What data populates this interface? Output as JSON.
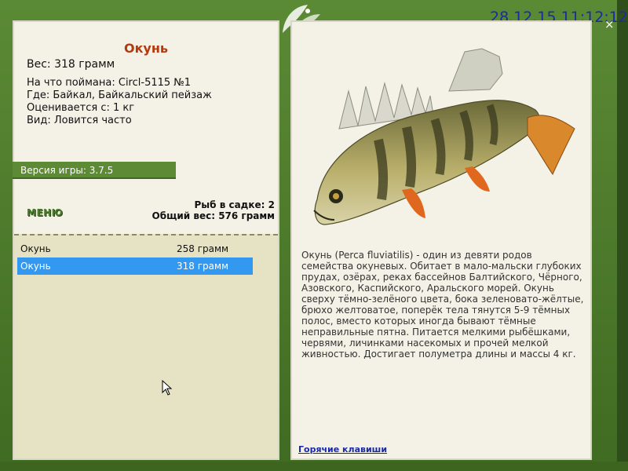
{
  "timestamp": "28.12.15 11:12:12",
  "fish": {
    "title": "Окунь",
    "weight_line": "Вес: 318 грамм",
    "caught_with": "На что поймана: Circl-5115 №1",
    "where": "Где: Байкал, Байкальский пейзаж",
    "valued_from": "Оценивается с: 1 кг",
    "kind": "Вид: Ловится часто"
  },
  "version": "Версия игры: 3.7.5",
  "menu_label": "МЕНЮ",
  "stats": {
    "in_net": "Рыб в садке: 2",
    "total_weight": "Общий вес: 576 грамм"
  },
  "catch_list": [
    {
      "name": "Окунь",
      "weight": "258 грамм"
    },
    {
      "name": "Окунь",
      "weight": "318 грамм"
    }
  ],
  "description": "Окунь (Perca fluviatilis) - один из девяти родов семейства окуневых. Обитает в мало-мальски глубоких прудах, озёрах, реках бассейнов Балтийского, Чёрного, Азовского, Каспийского, Аральского морей. Окунь сверху тёмно-зелёного цвета, бока зеленовато-жёлтые, брюхо желтоватое, поперёк тела тянутся 5-9 тёмных полос, вместо которых иногда бывают тёмные неправильные пятна. Питается мелкими рыбёшками, червями, личинками насекомых и прочей мелкой живностью. Достигает полуметра длины и массы 4 кг.",
  "hotkeys_label": "Горячие клавиши",
  "close_label": "×",
  "colors": {
    "frame": "#4a7a2c",
    "panel": "#f4f2e6",
    "title": "#b23a10",
    "selected": "#3399f0",
    "link": "#1a2aa6"
  }
}
